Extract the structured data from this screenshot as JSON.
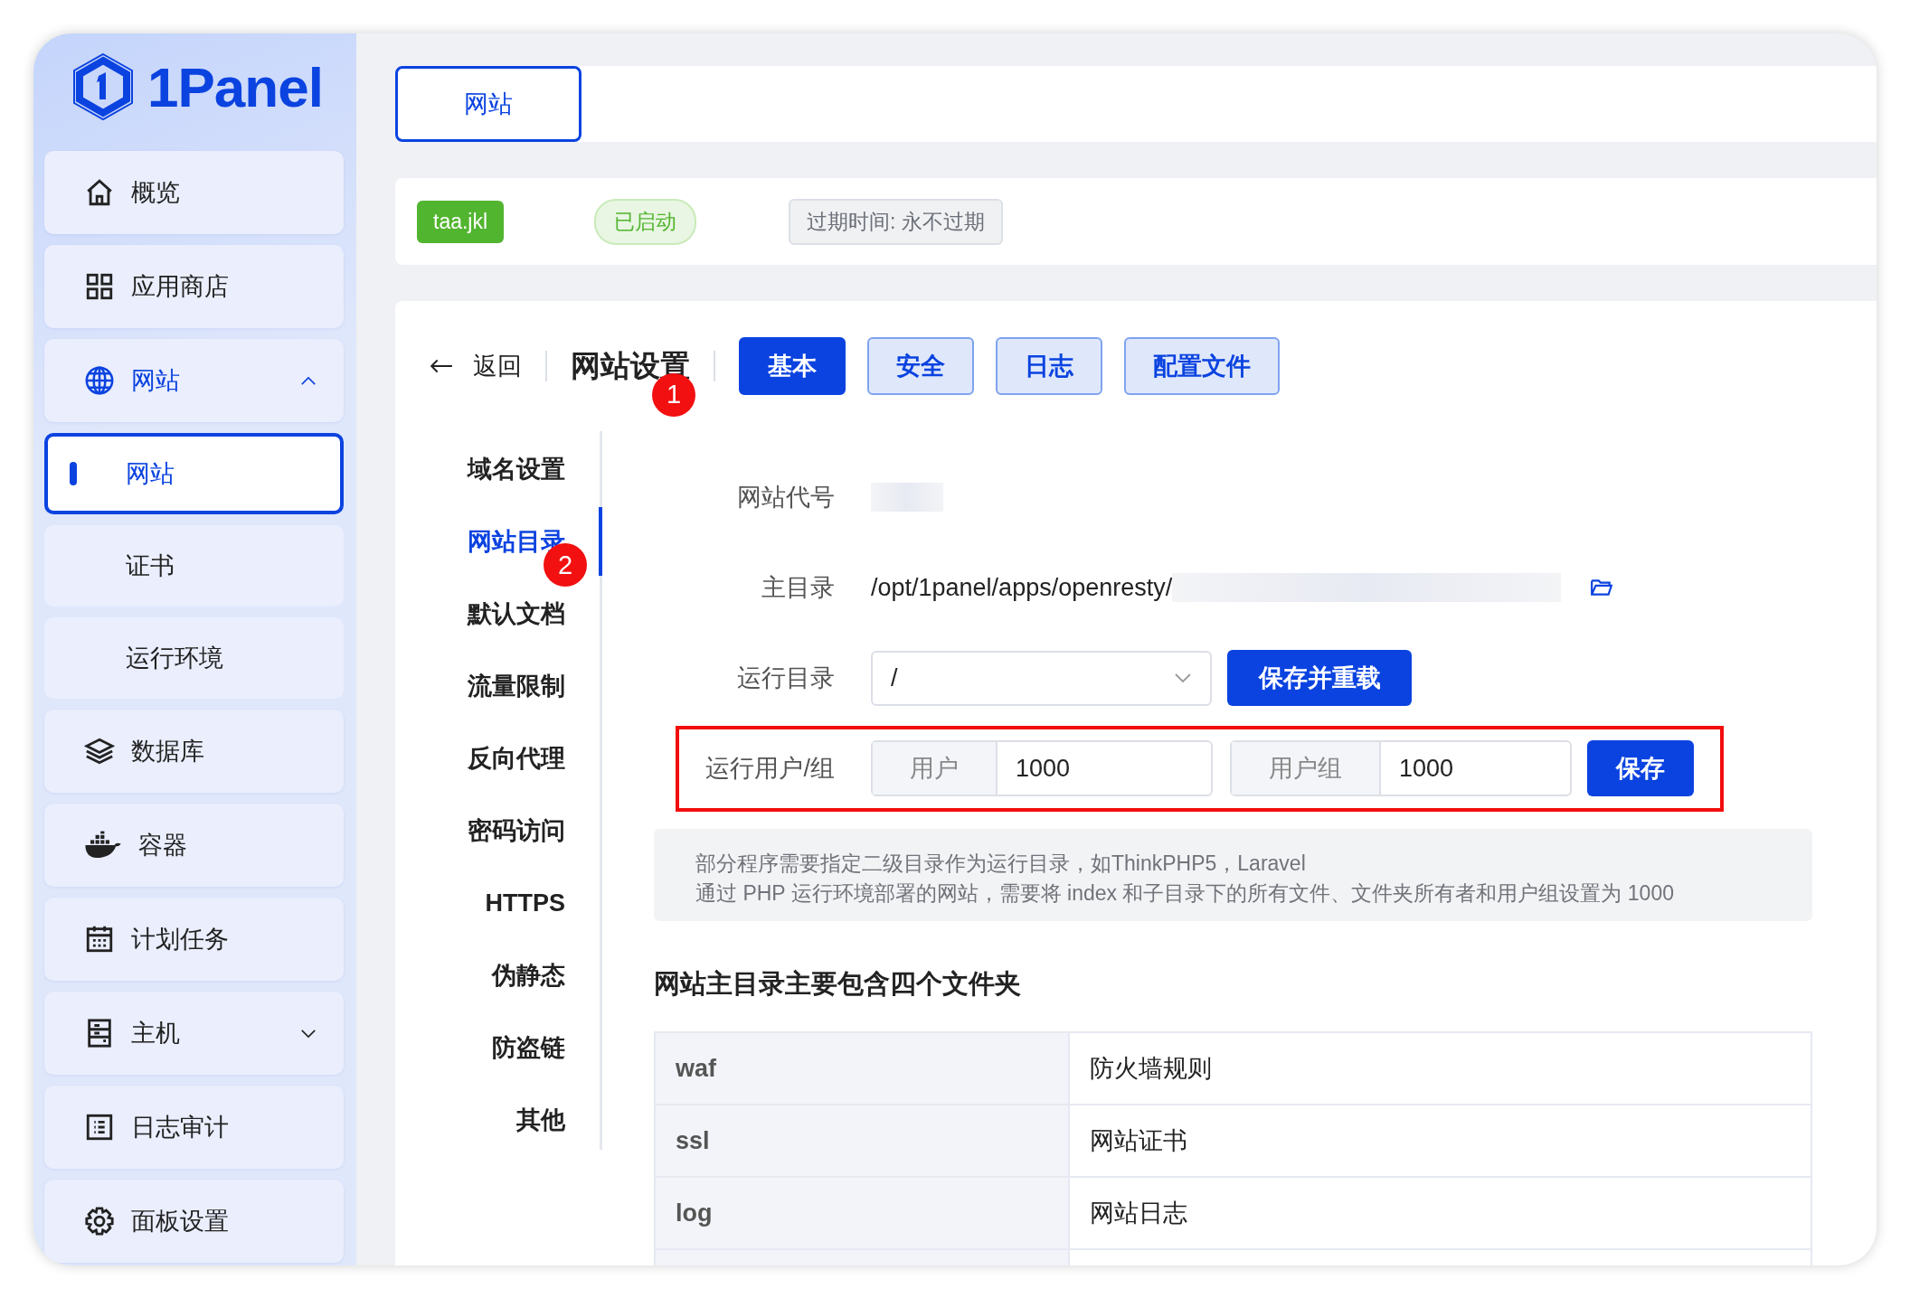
{
  "brand": {
    "name": "1Panel"
  },
  "sidebar": {
    "items": [
      {
        "kind": "link",
        "label": "概览",
        "selected": false
      },
      {
        "kind": "link",
        "label": "应用商店",
        "selected": false
      },
      {
        "kind": "group",
        "label": "网站",
        "selected": true,
        "expanded": true,
        "children": [
          {
            "label": "网站",
            "selected": true
          },
          {
            "label": "证书",
            "selected": false
          },
          {
            "label": "运行环境",
            "selected": false
          }
        ]
      },
      {
        "kind": "link",
        "label": "数据库",
        "selected": false
      },
      {
        "kind": "link",
        "label": "容器",
        "selected": false
      },
      {
        "kind": "link",
        "label": "计划任务",
        "selected": false
      },
      {
        "kind": "group",
        "label": "主机",
        "selected": false,
        "expanded": false
      },
      {
        "kind": "link",
        "label": "日志审计",
        "selected": false
      },
      {
        "kind": "link",
        "label": "面板设置",
        "selected": false
      }
    ]
  },
  "tabs": [
    {
      "label": "网站",
      "selected": true
    }
  ],
  "site": {
    "name_tag": "taa.jkl",
    "status": "已启动",
    "expiry": "过期时间: 永不过期"
  },
  "settings": {
    "back": "返回",
    "title": "网站设置",
    "title_marker": "1",
    "tabs": [
      {
        "label": "基本",
        "selected": true
      },
      {
        "label": "安全",
        "selected": false
      },
      {
        "label": "日志",
        "selected": false
      },
      {
        "label": "配置文件",
        "selected": false
      }
    ],
    "menu": [
      {
        "label": "域名设置",
        "selected": false
      },
      {
        "label": "网站目录",
        "selected": true,
        "marker": "2"
      },
      {
        "label": "默认文档",
        "selected": false
      },
      {
        "label": "流量限制",
        "selected": false
      },
      {
        "label": "反向代理",
        "selected": false
      },
      {
        "label": "密码访问",
        "selected": false
      },
      {
        "label": "HTTPS",
        "selected": false
      },
      {
        "label": "伪静态",
        "selected": false
      },
      {
        "label": "防盗链",
        "selected": false
      },
      {
        "label": "其他",
        "selected": false
      }
    ]
  },
  "form": {
    "site_code": {
      "label": "网站代号"
    },
    "root": {
      "label": "主目录",
      "value": "/opt/1panel/apps/openresty/"
    },
    "run_dir": {
      "label": "运行目录",
      "value": "/",
      "button": "保存并重载"
    },
    "run_user": {
      "label": "运行用户/组",
      "user_prefix": "用户",
      "user_value": "1000",
      "group_prefix": "用户组",
      "group_value": "1000",
      "button": "保存",
      "highlighted": true
    }
  },
  "note": [
    "部分程序需要指定二级目录作为运行目录，如ThinkPHP5，Laravel",
    "通过 PHP 运行环境部署的网站，需要将 index 和子目录下的所有文件、文件夹所有者和用户组设置为 1000"
  ],
  "folders": {
    "heading": "网站主目录主要包含四个文件夹",
    "rows": [
      {
        "name": "waf",
        "description": "防火墙规则"
      },
      {
        "name": "ssl",
        "description": "网站证书"
      },
      {
        "name": "log",
        "description": "网站日志"
      }
    ]
  }
}
